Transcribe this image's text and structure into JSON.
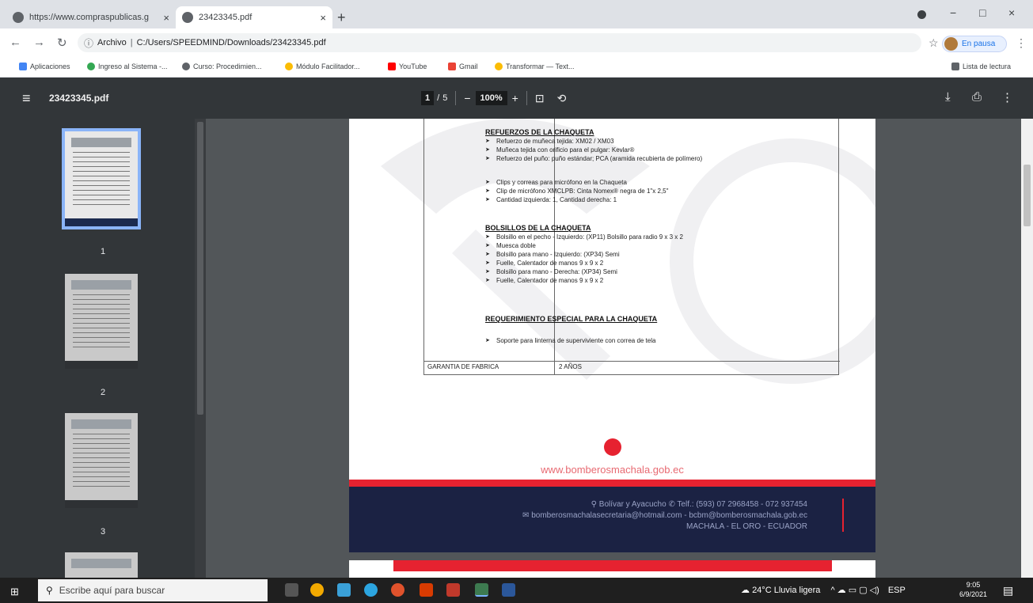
{
  "browser": {
    "tabs": [
      {
        "title": "https://www.compraspublicas.g",
        "active": false
      },
      {
        "title": "23423345.pdf",
        "active": true
      }
    ],
    "new_tab": "+",
    "window_controls": {
      "minimize": "−",
      "maximize": "□",
      "close": "×"
    },
    "address": {
      "security_label": "Archivo",
      "path": "C:/Users/SPEEDMIND/Downloads/23423345.pdf"
    },
    "profile_label": "En pausa",
    "bookmarks": [
      {
        "label": "Aplicaciones",
        "color": "#4285f4"
      },
      {
        "label": "Ingreso al Sistema -...",
        "color": "#34a853"
      },
      {
        "label": "Curso: Procedimien...",
        "color": "#5f6368"
      },
      {
        "label": "Módulo Facilitador...",
        "color": "#fbbc04"
      },
      {
        "label": "YouTube",
        "color": "#ff0000"
      },
      {
        "label": "Gmail",
        "color": "#ea4335"
      },
      {
        "label": "Transformar — Text...",
        "color": "#fbbc04"
      }
    ],
    "reading_list": "Lista de lectura"
  },
  "pdf_toolbar": {
    "filename": "23423345.pdf",
    "current_page": "1",
    "page_sep": "/",
    "total_pages": "5",
    "zoom_out": "−",
    "zoom": "100%",
    "zoom_in": "+"
  },
  "thumbnails": [
    {
      "label": "1",
      "selected": true
    },
    {
      "label": "2",
      "selected": false
    },
    {
      "label": "3",
      "selected": false
    }
  ],
  "document": {
    "sections": [
      {
        "heading": "REFUERZOS DE LA CHAQUETA",
        "items": [
          "Refuerzo de muñeca tejida: XM02 / XM03",
          "Muñeca tejida con orificio para el pulgar: Kevlar®",
          "Refuerzo del puño: puño estándar; PCA (aramida recubierta de polímero)",
          "Clips y correas para micrófono en la Chaqueta",
          "Clip de micrófono XMCLPB: Cinta Nomex® negra de 1\"x 2,5\"",
          "Cantidad izquierda: 1, Cantidad derecha: 1"
        ]
      },
      {
        "heading": "BOLSILLOS DE LA CHAQUETA",
        "items": [
          "Bolsillo en el pecho - Izquierdo: (XP11) Bolsillo para radio 9 x 3 x 2",
          "Muesca doble",
          "Bolsillo para mano - Izquierdo: (XP34) Semi",
          "Fuelle, Calentador de manos 9 x 9 x 2",
          "Bolsillo para mano - Derecha: (XP34) Semi",
          "Fuelle, Calentador de manos 9 x 9 x 2"
        ]
      },
      {
        "heading": "REQUERIMIENTO ESPECIAL PARA LA CHAQUETA",
        "items": [
          "Soporte para linterna de superviviente con correa de tela"
        ]
      }
    ],
    "warranty_label": "GARANTIA DE FABRICA",
    "warranty_value": "2 AÑOS",
    "website": "www.bomberosmachala.gob.ec",
    "footer": {
      "address": "Bolívar y Ayacucho",
      "phone": "Telf.: (593) 07 2968458 - 072 937454",
      "email": "bomberosmachalasecretaria@hotmail.com - bcbm@bomberosmachala.gob.ec",
      "city": "MACHALA - EL ORO - ECUADOR"
    }
  },
  "taskbar": {
    "search_placeholder": "Escribe aquí para buscar",
    "weather": "24°C Lluvia ligera",
    "lang": "ESP",
    "time": "9:05",
    "date": "6/9/2021"
  }
}
